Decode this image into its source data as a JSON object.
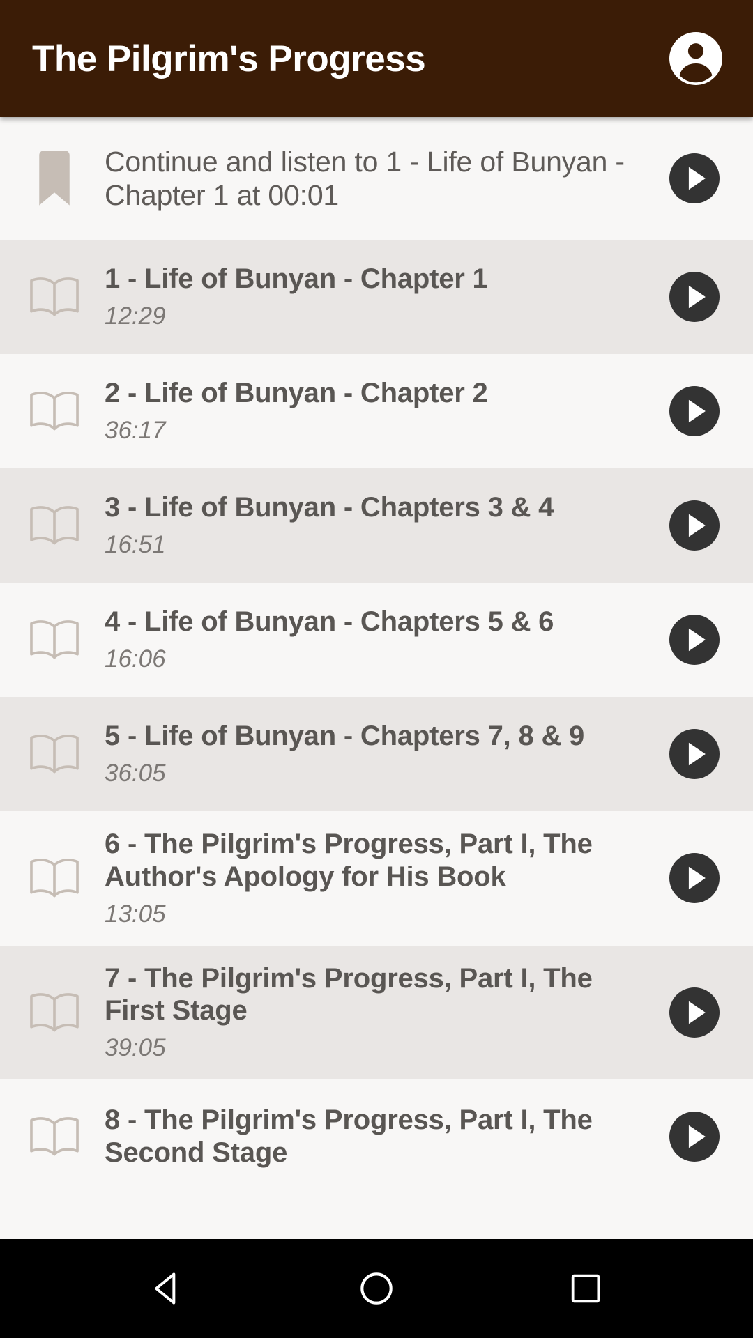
{
  "appbar": {
    "title": "The Pilgrim's Progress",
    "account_icon": "account-circle-icon",
    "background_color": "#3b1c06",
    "title_color": "#ffffff"
  },
  "continue": {
    "icon": "bookmark-icon",
    "text": "Continue and listen to 1 - Life of Bunyan - Chapter 1 at 00:01",
    "play_label": "play-icon"
  },
  "colors": {
    "row_alt": "#e9e6e4",
    "row_plain": "#f8f7f6",
    "icon_tan": "#c6bdb5",
    "play_circle": "#333333",
    "title_text": "#595653",
    "duration_text": "#7c7875"
  },
  "tracks": [
    {
      "icon": "book-icon",
      "title": "1 - Life of Bunyan - Chapter 1",
      "duration": "12:29",
      "play_label": "play-icon"
    },
    {
      "icon": "book-icon",
      "title": "2 - Life of Bunyan - Chapter 2",
      "duration": "36:17",
      "play_label": "play-icon"
    },
    {
      "icon": "book-icon",
      "title": "3 - Life of Bunyan - Chapters 3 & 4",
      "duration": "16:51",
      "play_label": "play-icon"
    },
    {
      "icon": "book-icon",
      "title": "4 - Life of Bunyan - Chapters 5 & 6",
      "duration": "16:06",
      "play_label": "play-icon"
    },
    {
      "icon": "book-icon",
      "title": "5 - Life of Bunyan - Chapters 7, 8 & 9",
      "duration": "36:05",
      "play_label": "play-icon"
    },
    {
      "icon": "book-icon",
      "title": "6 - The Pilgrim's Progress, Part I, The Author's Apology for His Book",
      "duration": "13:05",
      "play_label": "play-icon"
    },
    {
      "icon": "book-icon",
      "title": "7 - The Pilgrim's Progress, Part I, The First Stage",
      "duration": "39:05",
      "play_label": "play-icon"
    },
    {
      "icon": "book-icon",
      "title": "8 - The Pilgrim's Progress, Part I, The Second Stage",
      "duration": "",
      "play_label": "play-icon"
    }
  ],
  "navbar": {
    "back": "back-triangle-icon",
    "home": "home-circle-icon",
    "recents": "recents-square-icon",
    "background_color": "#000000"
  }
}
